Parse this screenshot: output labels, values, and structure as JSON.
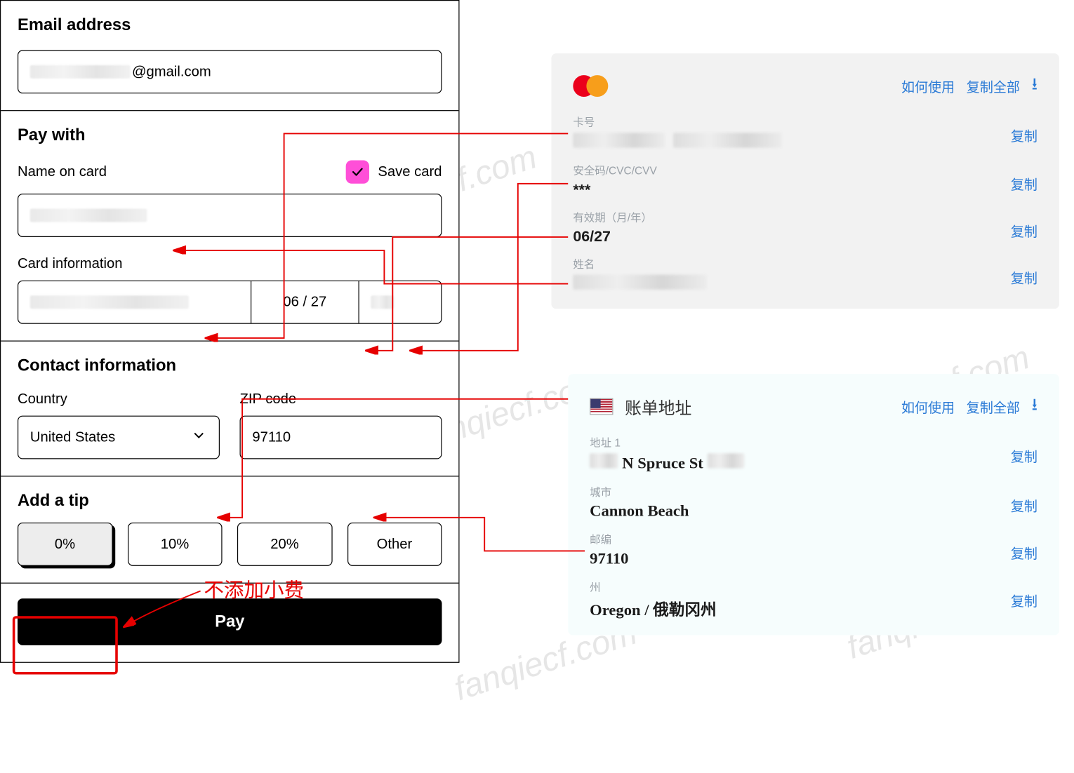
{
  "checkout": {
    "email_label": "Email address",
    "email_masked_suffix": "@gmail.com",
    "pay_with_label": "Pay with",
    "name_on_card_label": "Name on card",
    "save_card_label": "Save card",
    "card_info_label": "Card information",
    "expiry_value": "06 / 27",
    "contact_label": "Contact information",
    "country_label": "Country",
    "country_value": "United States",
    "zip_label": "ZIP code",
    "zip_value": "97110",
    "tip_label": "Add a tip",
    "tips": [
      "0%",
      "10%",
      "20%",
      "Other"
    ],
    "pay_button": "Pay"
  },
  "card_panel": {
    "how_to_use": "如何使用",
    "copy_all": "复制全部",
    "download_icon": "⭳",
    "copy": "复制",
    "card_number_label": "卡号",
    "cvv_label": "安全码/CVC/CVV",
    "cvv_value": "***",
    "expiry_label": "有效期（月/年）",
    "expiry_value": "06/27",
    "name_label": "姓名"
  },
  "addr_panel": {
    "title": "账单地址",
    "how_to_use": "如何使用",
    "copy_all": "复制全部",
    "download_icon": "⭳",
    "copy": "复制",
    "addr1_label": "地址 1",
    "addr1_masked_mid": "N Spruce St",
    "city_label": "城市",
    "city_value": "Cannon Beach",
    "zip_label": "邮编",
    "zip_value": "97110",
    "state_label": "州",
    "state_value": "Oregon / 俄勒冈州"
  },
  "annotation": {
    "tip_text": "不添加小费"
  },
  "watermark": "fanqiecf.com"
}
